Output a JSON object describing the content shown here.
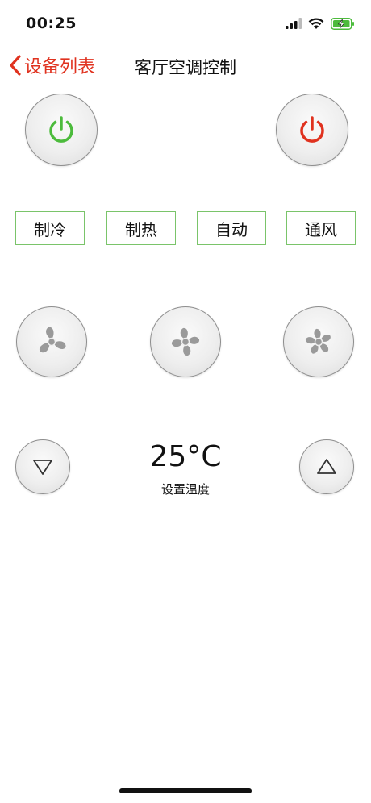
{
  "status_bar": {
    "time": "00:25"
  },
  "nav": {
    "back_label": "设备列表",
    "title": "客厅空调控制"
  },
  "power": {
    "on_color": "#4cbb3c",
    "off_color": "#e0321f"
  },
  "modes": [
    {
      "label": "制冷"
    },
    {
      "label": "制热"
    },
    {
      "label": "自动"
    },
    {
      "label": "通风"
    }
  ],
  "fan_speeds": [
    "fan-low-icon",
    "fan-medium-icon",
    "fan-high-icon"
  ],
  "temperature": {
    "value": "25°C",
    "label": "设置温度"
  },
  "colors": {
    "accent": "#e0321f",
    "mode_border": "#7ac46a"
  }
}
